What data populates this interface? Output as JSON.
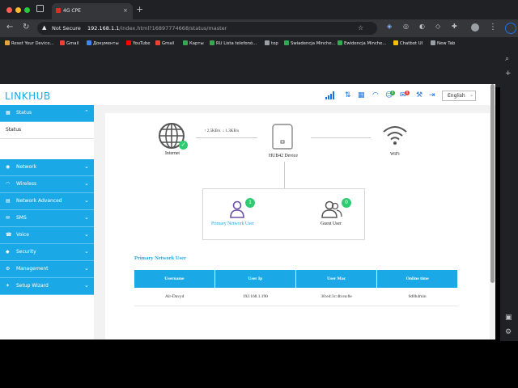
{
  "browser": {
    "tab_title": "4G CPE",
    "tab_close": "×",
    "new_tab": "+",
    "security_label": "Not Secure",
    "url_host": "192.168.1.1",
    "url_path": "/index.html?16897774668/status/master",
    "bookmarks": [
      {
        "label": "Reset Your Device...",
        "color": "#e8a33c"
      },
      {
        "label": "Gmail",
        "color": "#ea4335"
      },
      {
        "label": "Документы",
        "color": "#4285f4"
      },
      {
        "label": "YouTube",
        "color": "#ff0000"
      },
      {
        "label": "Gmail",
        "color": "#ea4335"
      },
      {
        "label": "Карты",
        "color": "#34a853"
      },
      {
        "label": "RU Lista telefonó...",
        "color": "#34a853"
      },
      {
        "label": "top",
        "color": "#9aa0a6"
      },
      {
        "label": "Swiadencja Minche...",
        "color": "#34a853"
      },
      {
        "label": "Ewidencja Minche...",
        "color": "#34a853"
      },
      {
        "label": "Chatbot UI",
        "color": "#fbbc04"
      },
      {
        "label": "New Tab",
        "color": "#9aa0a6"
      }
    ]
  },
  "header": {
    "logo": "LINKHUB",
    "language": "English",
    "badges": {
      "messages": "0",
      "alerts": "0"
    }
  },
  "sidebar": {
    "items": [
      {
        "label": "Status",
        "icon": "grid-icon",
        "glyph": "▦",
        "chevron": "⌃"
      },
      {
        "label": "Network",
        "icon": "globe-icon",
        "glyph": "◉",
        "chevron": "⌄"
      },
      {
        "label": "Wireless",
        "icon": "wifi-icon",
        "glyph": "◠",
        "chevron": "⌄"
      },
      {
        "label": "Network Advanced",
        "icon": "network-icon",
        "glyph": "▤",
        "chevron": "⌄"
      },
      {
        "label": "SMS",
        "icon": "envelope-icon",
        "glyph": "✉",
        "chevron": "⌄"
      },
      {
        "label": "Voice",
        "icon": "phone-icon",
        "glyph": "☎",
        "chevron": "⌄"
      },
      {
        "label": "Security",
        "icon": "shield-icon",
        "glyph": "◆",
        "chevron": "⌄"
      },
      {
        "label": "Management",
        "icon": "gear-icon",
        "glyph": "⚙",
        "chevron": "⌄"
      },
      {
        "label": "Setup Wizard",
        "icon": "wand-icon",
        "glyph": "✦",
        "chevron": "⌄"
      }
    ],
    "subitem": "Status"
  },
  "status": {
    "internet_label": "Internet",
    "upload_rate": "2.5KB/s",
    "download_rate": "1.3KB/s",
    "device_label": "HUB42 Device",
    "wifi_label": "WiFi",
    "primary_user_label": "Primary Network User",
    "primary_user_count": "1",
    "guest_user_label": "Guest User",
    "guest_user_count": "0"
  },
  "table": {
    "title": "Primary Network User",
    "headers": [
      "Username",
      "User Ip",
      "User Mac",
      "Online time"
    ],
    "rows": [
      [
        "Air-Davyd",
        "192.168.1.190",
        "30:ed:3c:4b:ea:8e",
        "0d0h4min"
      ]
    ]
  },
  "colors": {
    "accent": "#1aa9e6",
    "success": "#2ecc71",
    "purple": "#6b4ea6"
  }
}
